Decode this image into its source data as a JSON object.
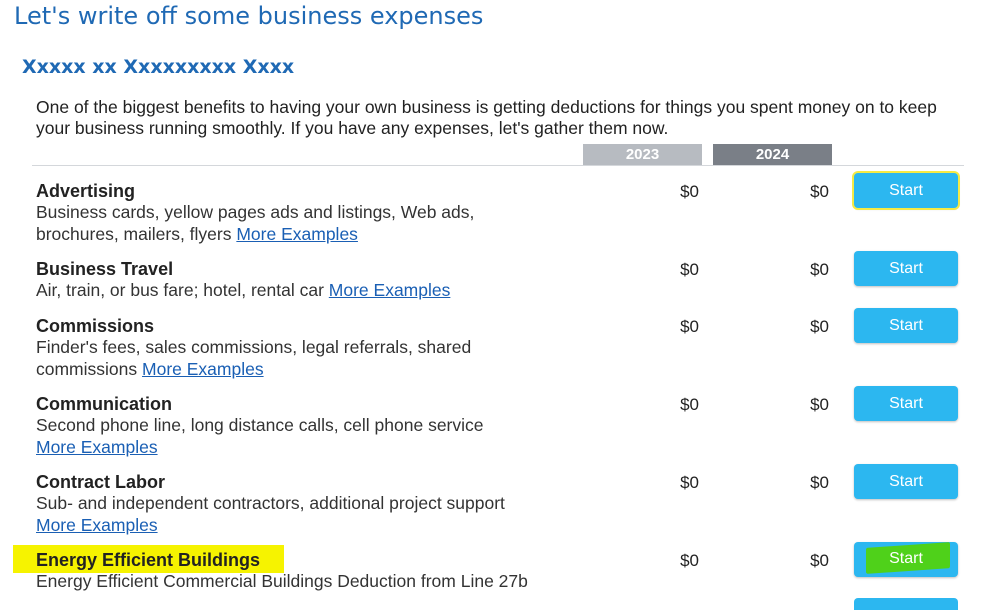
{
  "page": {
    "title": "Let's write off some business expenses",
    "subtitle": "Xxxxx xx Xxxxxxxxx Xxxx",
    "intro": "One of the biggest benefits to having your own business is getting deductions for things you spent money on to keep your business running smoothly. If you have any expenses, let's gather them now."
  },
  "columns": {
    "year1": "2023",
    "year2": "2024"
  },
  "rows": [
    {
      "title": "Advertising",
      "desc": "Business cards, yellow pages ads and listings, Web ads, brochures, mailers, flyers",
      "more": "More Examples",
      "amt1": "$0",
      "amt2": "$0",
      "button": "Start"
    },
    {
      "title": "Business Travel",
      "desc": "Air, train, or bus fare; hotel, rental car",
      "more": "More Examples",
      "amt1": "$0",
      "amt2": "$0",
      "button": "Start"
    },
    {
      "title": "Commissions",
      "desc": "Finder's fees, sales commissions, legal referrals, shared commissions",
      "more": "More Examples",
      "amt1": "$0",
      "amt2": "$0",
      "button": "Start"
    },
    {
      "title": "Communication",
      "desc": "Second phone line, long distance calls, cell phone service",
      "more": "More Examples",
      "amt1": "$0",
      "amt2": "$0",
      "button": "Start"
    },
    {
      "title": "Contract Labor",
      "desc": "Sub- and independent contractors, additional project support",
      "more": "More Examples",
      "amt1": "$0",
      "amt2": "$0",
      "button": "Start"
    },
    {
      "title": "Energy Efficient Buildings",
      "desc": "Energy Efficient Commercial Buildings Deduction from Line 27b",
      "amt1": "$0",
      "amt2": "$0",
      "button": "Start"
    }
  ],
  "colors": {
    "title": "#1f69b4",
    "button": "#2cb7f0",
    "link": "#1a5fb4",
    "highlight_yellow": "#f6f300",
    "highlight_green": "#4fd11a"
  }
}
